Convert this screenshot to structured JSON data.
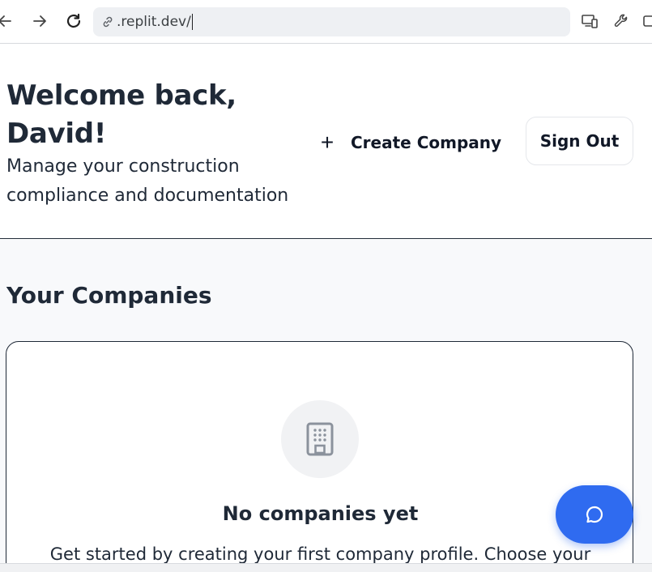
{
  "browser": {
    "url": ".replit.dev/",
    "icons": {
      "back": "arrow-left-icon",
      "forward": "arrow-right-icon",
      "reload": "reload-icon",
      "link": "link-icon",
      "devices": "devices-icon",
      "wrench": "wrench-icon",
      "extension": "window-icon"
    }
  },
  "header": {
    "welcome": "Welcome back, David!",
    "subtitle": "Manage your construction compliance and documentation",
    "create_company_label": "Create Company",
    "sign_out_label": "Sign Out"
  },
  "main": {
    "section_title": "Your Companies",
    "empty_state": {
      "icon": "building-icon",
      "title": "No companies yet",
      "description": "Get started by creating your first company profile. Choose your"
    }
  },
  "chat": {
    "icon": "chat-bubble-icon"
  },
  "colors": {
    "accent": "#2f6bf0",
    "text": "#1f2937",
    "main_bg": "#f8f9fb"
  }
}
